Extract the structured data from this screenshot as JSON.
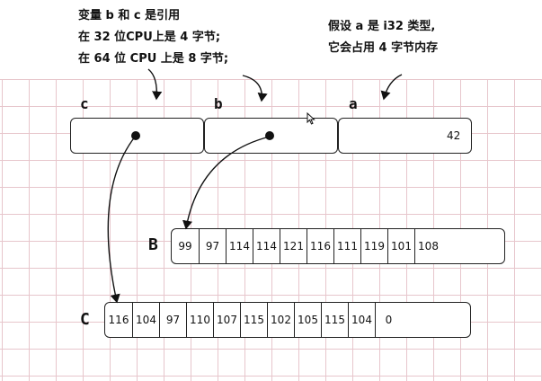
{
  "notes": {
    "left": [
      "变量 b 和 c 是引用",
      "在 32 位CPU上是 4 字节;",
      "在 64 位 CPU 上是 8 字节;"
    ],
    "right": [
      "假设 a 是 i32 类型,",
      "它会占用 4 字节内存"
    ]
  },
  "variables": [
    {
      "label": "c"
    },
    {
      "label": "b"
    },
    {
      "label": "a",
      "value": "42"
    }
  ],
  "arrays": {
    "B": {
      "label": "B",
      "cells": [
        "99",
        "97",
        "114",
        "114",
        "121",
        "116",
        "111",
        "119",
        "101",
        "108"
      ]
    },
    "C": {
      "label": "C",
      "cells": [
        "116",
        "104",
        "97",
        "110",
        "107",
        "115",
        "102",
        "105",
        "115",
        "104",
        "0"
      ]
    }
  }
}
